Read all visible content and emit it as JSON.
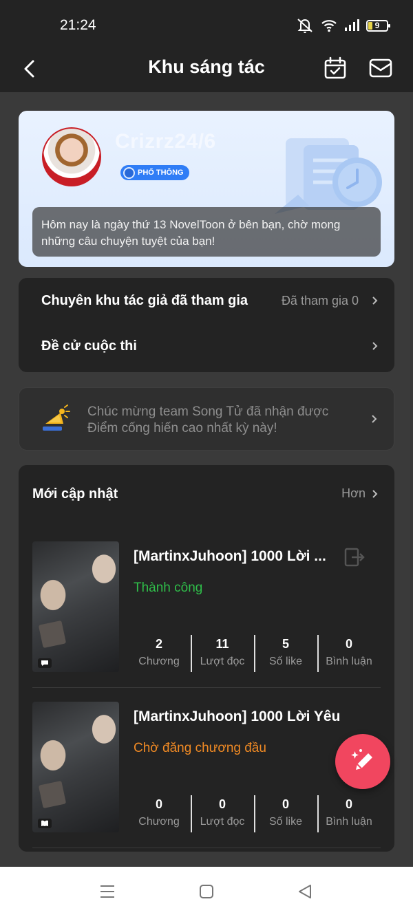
{
  "status_bar": {
    "time": "21:24",
    "battery": "9"
  },
  "header": {
    "title": "Khu sáng tác"
  },
  "profile": {
    "username": "Crizrz24/6",
    "level": "PHỔ THÔNG",
    "greeting": "Hôm nay là ngày thứ 13 NovelToon ở bên bạn, chờ mong những câu chuyện tuyệt của bạn!"
  },
  "menu": {
    "items": [
      {
        "label": "Chuyên khu tác giả đã tham gia",
        "value": "Đã tham gia 0"
      },
      {
        "label": "Đề cử cuộc thi",
        "value": ""
      }
    ]
  },
  "notice": {
    "text": "Chúc mừng team Song Tử đã nhận được Điểm cống hiến cao nhất kỳ này!"
  },
  "updates": {
    "title": "Mới cập nhật",
    "more": "Hơn",
    "books": [
      {
        "title": "[MartinxJuhoon] 1000 Lời ...",
        "status": "Thành công",
        "stats": [
          {
            "value": "2",
            "label": "Chương"
          },
          {
            "value": "11",
            "label": "Lượt đọc"
          },
          {
            "value": "5",
            "label": "Số like"
          },
          {
            "value": "0",
            "label": "Bình luận"
          }
        ]
      },
      {
        "title": "[MartinxJuhoon] 1000 Lời Yêu",
        "status": "Chờ đăng chương đầu",
        "stats": [
          {
            "value": "0",
            "label": "Chương"
          },
          {
            "value": "0",
            "label": "Lượt đọc"
          },
          {
            "value": "0",
            "label": "Số like"
          },
          {
            "value": "0",
            "label": "Bình luận"
          }
        ]
      }
    ]
  },
  "colors": {
    "status_success": "#2fbf4a",
    "status_pending": "#f08a24",
    "fab": "#f1465f",
    "level_badge": "#2f7df6"
  }
}
